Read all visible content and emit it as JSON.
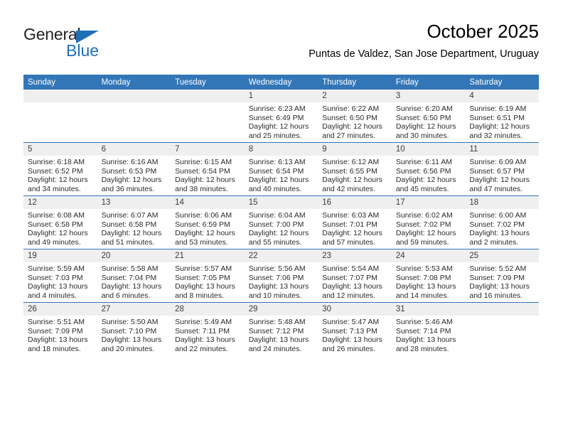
{
  "brand": {
    "name_part1": "General",
    "name_part2": "Blue",
    "triangle_icon": "triangle-icon"
  },
  "header": {
    "title": "October 2025",
    "subtitle": "Puntas de Valdez, San Jose Department, Uruguay"
  },
  "colors": {
    "header_blue": "#3276b8",
    "brand_blue": "#1f6fb8",
    "daynum_bg": "#efefef",
    "text": "#2b2b2b"
  },
  "weekdays": [
    "Sunday",
    "Monday",
    "Tuesday",
    "Wednesday",
    "Thursday",
    "Friday",
    "Saturday"
  ],
  "labels": {
    "sunrise_prefix": "Sunrise:",
    "sunset_prefix": "Sunset:",
    "daylight_prefix": "Daylight:"
  },
  "weeks": [
    [
      {
        "day": "",
        "sunrise": "",
        "sunset": "",
        "daylight_line1": "",
        "daylight_line2": ""
      },
      {
        "day": "",
        "sunrise": "",
        "sunset": "",
        "daylight_line1": "",
        "daylight_line2": ""
      },
      {
        "day": "",
        "sunrise": "",
        "sunset": "",
        "daylight_line1": "",
        "daylight_line2": ""
      },
      {
        "day": "1",
        "sunrise": "Sunrise: 6:23 AM",
        "sunset": "Sunset: 6:49 PM",
        "daylight_line1": "Daylight: 12 hours",
        "daylight_line2": "and 25 minutes."
      },
      {
        "day": "2",
        "sunrise": "Sunrise: 6:22 AM",
        "sunset": "Sunset: 6:50 PM",
        "daylight_line1": "Daylight: 12 hours",
        "daylight_line2": "and 27 minutes."
      },
      {
        "day": "3",
        "sunrise": "Sunrise: 6:20 AM",
        "sunset": "Sunset: 6:50 PM",
        "daylight_line1": "Daylight: 12 hours",
        "daylight_line2": "and 30 minutes."
      },
      {
        "day": "4",
        "sunrise": "Sunrise: 6:19 AM",
        "sunset": "Sunset: 6:51 PM",
        "daylight_line1": "Daylight: 12 hours",
        "daylight_line2": "and 32 minutes."
      }
    ],
    [
      {
        "day": "5",
        "sunrise": "Sunrise: 6:18 AM",
        "sunset": "Sunset: 6:52 PM",
        "daylight_line1": "Daylight: 12 hours",
        "daylight_line2": "and 34 minutes."
      },
      {
        "day": "6",
        "sunrise": "Sunrise: 6:16 AM",
        "sunset": "Sunset: 6:53 PM",
        "daylight_line1": "Daylight: 12 hours",
        "daylight_line2": "and 36 minutes."
      },
      {
        "day": "7",
        "sunrise": "Sunrise: 6:15 AM",
        "sunset": "Sunset: 6:54 PM",
        "daylight_line1": "Daylight: 12 hours",
        "daylight_line2": "and 38 minutes."
      },
      {
        "day": "8",
        "sunrise": "Sunrise: 6:13 AM",
        "sunset": "Sunset: 6:54 PM",
        "daylight_line1": "Daylight: 12 hours",
        "daylight_line2": "and 40 minutes."
      },
      {
        "day": "9",
        "sunrise": "Sunrise: 6:12 AM",
        "sunset": "Sunset: 6:55 PM",
        "daylight_line1": "Daylight: 12 hours",
        "daylight_line2": "and 42 minutes."
      },
      {
        "day": "10",
        "sunrise": "Sunrise: 6:11 AM",
        "sunset": "Sunset: 6:56 PM",
        "daylight_line1": "Daylight: 12 hours",
        "daylight_line2": "and 45 minutes."
      },
      {
        "day": "11",
        "sunrise": "Sunrise: 6:09 AM",
        "sunset": "Sunset: 6:57 PM",
        "daylight_line1": "Daylight: 12 hours",
        "daylight_line2": "and 47 minutes."
      }
    ],
    [
      {
        "day": "12",
        "sunrise": "Sunrise: 6:08 AM",
        "sunset": "Sunset: 6:58 PM",
        "daylight_line1": "Daylight: 12 hours",
        "daylight_line2": "and 49 minutes."
      },
      {
        "day": "13",
        "sunrise": "Sunrise: 6:07 AM",
        "sunset": "Sunset: 6:58 PM",
        "daylight_line1": "Daylight: 12 hours",
        "daylight_line2": "and 51 minutes."
      },
      {
        "day": "14",
        "sunrise": "Sunrise: 6:06 AM",
        "sunset": "Sunset: 6:59 PM",
        "daylight_line1": "Daylight: 12 hours",
        "daylight_line2": "and 53 minutes."
      },
      {
        "day": "15",
        "sunrise": "Sunrise: 6:04 AM",
        "sunset": "Sunset: 7:00 PM",
        "daylight_line1": "Daylight: 12 hours",
        "daylight_line2": "and 55 minutes."
      },
      {
        "day": "16",
        "sunrise": "Sunrise: 6:03 AM",
        "sunset": "Sunset: 7:01 PM",
        "daylight_line1": "Daylight: 12 hours",
        "daylight_line2": "and 57 minutes."
      },
      {
        "day": "17",
        "sunrise": "Sunrise: 6:02 AM",
        "sunset": "Sunset: 7:02 PM",
        "daylight_line1": "Daylight: 12 hours",
        "daylight_line2": "and 59 minutes."
      },
      {
        "day": "18",
        "sunrise": "Sunrise: 6:00 AM",
        "sunset": "Sunset: 7:02 PM",
        "daylight_line1": "Daylight: 13 hours",
        "daylight_line2": "and 2 minutes."
      }
    ],
    [
      {
        "day": "19",
        "sunrise": "Sunrise: 5:59 AM",
        "sunset": "Sunset: 7:03 PM",
        "daylight_line1": "Daylight: 13 hours",
        "daylight_line2": "and 4 minutes."
      },
      {
        "day": "20",
        "sunrise": "Sunrise: 5:58 AM",
        "sunset": "Sunset: 7:04 PM",
        "daylight_line1": "Daylight: 13 hours",
        "daylight_line2": "and 6 minutes."
      },
      {
        "day": "21",
        "sunrise": "Sunrise: 5:57 AM",
        "sunset": "Sunset: 7:05 PM",
        "daylight_line1": "Daylight: 13 hours",
        "daylight_line2": "and 8 minutes."
      },
      {
        "day": "22",
        "sunrise": "Sunrise: 5:56 AM",
        "sunset": "Sunset: 7:06 PM",
        "daylight_line1": "Daylight: 13 hours",
        "daylight_line2": "and 10 minutes."
      },
      {
        "day": "23",
        "sunrise": "Sunrise: 5:54 AM",
        "sunset": "Sunset: 7:07 PM",
        "daylight_line1": "Daylight: 13 hours",
        "daylight_line2": "and 12 minutes."
      },
      {
        "day": "24",
        "sunrise": "Sunrise: 5:53 AM",
        "sunset": "Sunset: 7:08 PM",
        "daylight_line1": "Daylight: 13 hours",
        "daylight_line2": "and 14 minutes."
      },
      {
        "day": "25",
        "sunrise": "Sunrise: 5:52 AM",
        "sunset": "Sunset: 7:09 PM",
        "daylight_line1": "Daylight: 13 hours",
        "daylight_line2": "and 16 minutes."
      }
    ],
    [
      {
        "day": "26",
        "sunrise": "Sunrise: 5:51 AM",
        "sunset": "Sunset: 7:09 PM",
        "daylight_line1": "Daylight: 13 hours",
        "daylight_line2": "and 18 minutes."
      },
      {
        "day": "27",
        "sunrise": "Sunrise: 5:50 AM",
        "sunset": "Sunset: 7:10 PM",
        "daylight_line1": "Daylight: 13 hours",
        "daylight_line2": "and 20 minutes."
      },
      {
        "day": "28",
        "sunrise": "Sunrise: 5:49 AM",
        "sunset": "Sunset: 7:11 PM",
        "daylight_line1": "Daylight: 13 hours",
        "daylight_line2": "and 22 minutes."
      },
      {
        "day": "29",
        "sunrise": "Sunrise: 5:48 AM",
        "sunset": "Sunset: 7:12 PM",
        "daylight_line1": "Daylight: 13 hours",
        "daylight_line2": "and 24 minutes."
      },
      {
        "day": "30",
        "sunrise": "Sunrise: 5:47 AM",
        "sunset": "Sunset: 7:13 PM",
        "daylight_line1": "Daylight: 13 hours",
        "daylight_line2": "and 26 minutes."
      },
      {
        "day": "31",
        "sunrise": "Sunrise: 5:46 AM",
        "sunset": "Sunset: 7:14 PM",
        "daylight_line1": "Daylight: 13 hours",
        "daylight_line2": "and 28 minutes."
      },
      {
        "day": "",
        "sunrise": "",
        "sunset": "",
        "daylight_line1": "",
        "daylight_line2": ""
      }
    ]
  ]
}
